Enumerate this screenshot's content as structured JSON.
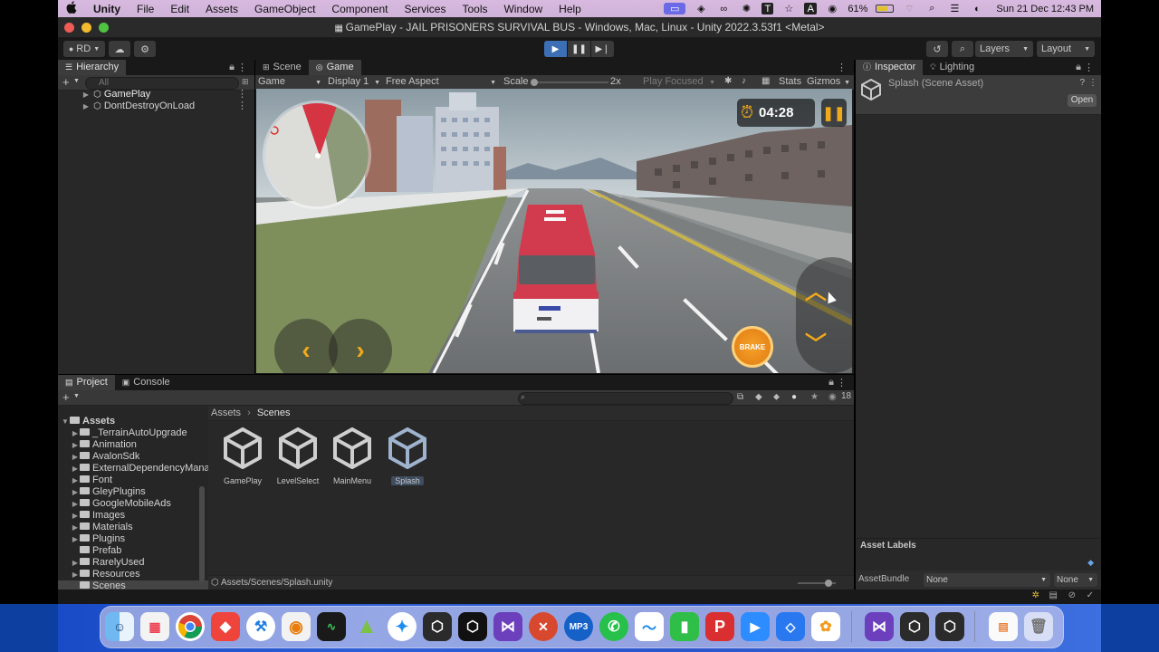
{
  "menubar": {
    "app_name": "Unity",
    "items": [
      "File",
      "Edit",
      "Assets",
      "GameObject",
      "Component",
      "Services",
      "Tools",
      "Window",
      "Help"
    ],
    "battery": "61%",
    "clock": "Sun 21 Dec  12:43 PM"
  },
  "window": {
    "title": "GamePlay - JAIL PRISONERS SURVIVAL BUS - Windows, Mac, Linux - Unity 2022.3.53f1 <Metal>"
  },
  "toolbar": {
    "account": "RD",
    "layers": "Layers",
    "layout": "Layout"
  },
  "hierarchy": {
    "tab": "Hierarchy",
    "search_placeholder": "All",
    "items": [
      "GamePlay",
      "DontDestroyOnLoad"
    ]
  },
  "game": {
    "tabs": [
      "Scene",
      "Game"
    ],
    "mode": "Game",
    "display": "Display 1",
    "aspect": "Free Aspect",
    "scale_label": "Scale",
    "scale_value": "2x",
    "play_focused": "Play Focused",
    "stats": "Stats",
    "gizmos": "Gizmos",
    "timer": "04:28",
    "brake_label": "BRAKE"
  },
  "inspector": {
    "tabs": [
      "Inspector",
      "Lighting"
    ],
    "asset_title": "Splash (Scene Asset)",
    "open_button": "Open",
    "asset_labels": "Asset Labels",
    "assetbundle_label": "AssetBundle",
    "assetbundle_value": "None",
    "variant_value": "None"
  },
  "project": {
    "tabs": [
      "Project",
      "Console"
    ],
    "hidden_count": "18",
    "tree_root": "Assets",
    "folders": [
      "_TerrainAutoUpgrade",
      "Animation",
      "AvalonSdk",
      "ExternalDependencyMana",
      "Font",
      "GleyPlugins",
      "GoogleMobileAds",
      "Images",
      "Materials",
      "Plugins",
      "Prefab",
      "RarelyUsed",
      "Resources",
      "Scenes"
    ],
    "breadcrumb": [
      "Assets",
      "Scenes"
    ],
    "assets": [
      "GamePlay",
      "LevelSelect",
      "MainMenu",
      "Splash"
    ],
    "status_path": "Assets/Scenes/Splash.unity"
  },
  "dock": {
    "apps": [
      "Finder",
      "Launchpad",
      "Chrome",
      "AnyDesk",
      "Xcode",
      "Blender",
      "Activity Monitor",
      "Android Studio",
      "Safari",
      "Unity Hub",
      "Unity",
      "Visual Studio",
      "Remote Desktop",
      "MP3 Converter",
      "WhatsApp",
      "Freeform",
      "Numbers",
      "WPS Office",
      "Zoom",
      "Notchmeister",
      "Photos",
      "Visual Studio Code",
      "Unity 2",
      "Unity 3",
      "Document",
      "Trash"
    ]
  }
}
